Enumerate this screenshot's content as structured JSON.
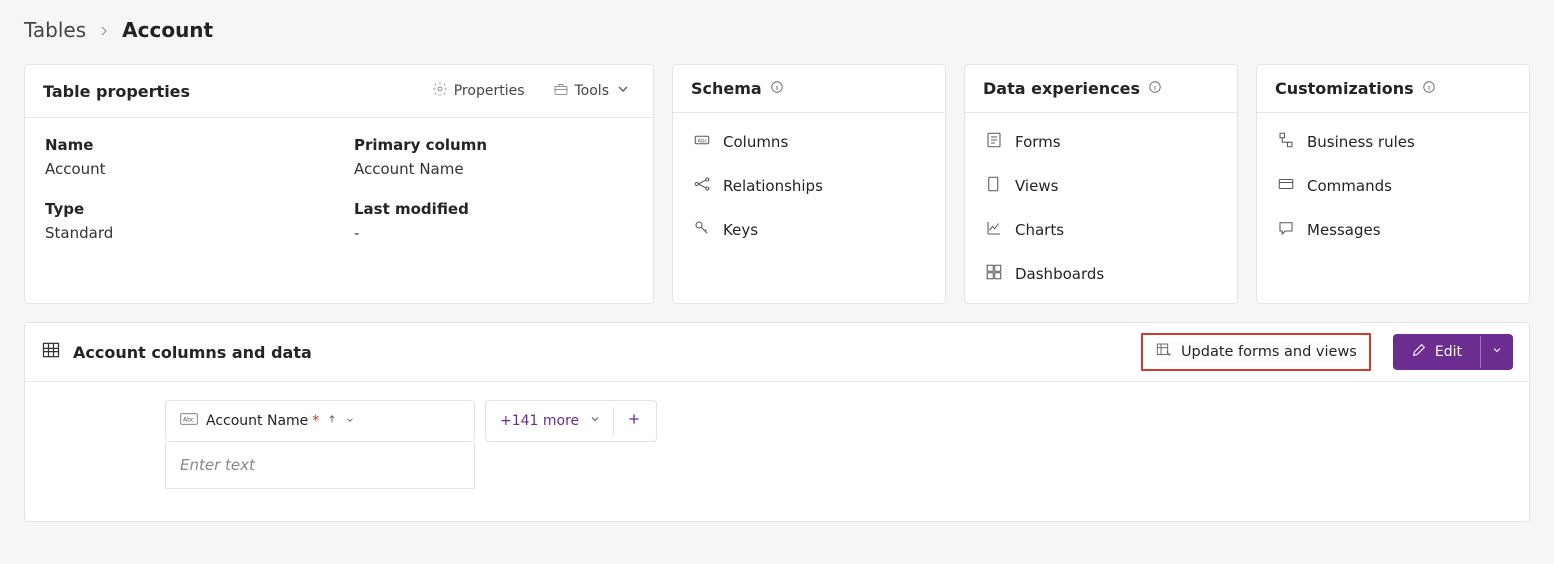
{
  "breadcrumb": {
    "root": "Tables",
    "current": "Account"
  },
  "table_properties": {
    "title": "Table properties",
    "properties_btn": "Properties",
    "tools_btn": "Tools",
    "labels": {
      "name": "Name",
      "primary_column": "Primary column",
      "type": "Type",
      "last_modified": "Last modified"
    },
    "values": {
      "name": "Account",
      "primary_column": "Account Name",
      "type": "Standard",
      "last_modified": "-"
    }
  },
  "schema": {
    "title": "Schema",
    "items": [
      {
        "label": "Columns"
      },
      {
        "label": "Relationships"
      },
      {
        "label": "Keys"
      }
    ]
  },
  "data_experiences": {
    "title": "Data experiences",
    "items": [
      {
        "label": "Forms"
      },
      {
        "label": "Views"
      },
      {
        "label": "Charts"
      },
      {
        "label": "Dashboards"
      }
    ]
  },
  "customizations": {
    "title": "Customizations",
    "items": [
      {
        "label": "Business rules"
      },
      {
        "label": "Commands"
      },
      {
        "label": "Messages"
      }
    ]
  },
  "data_section": {
    "title": "Account columns and data",
    "update_btn": "Update forms and views",
    "edit_btn": "Edit",
    "column_name": "Account Name",
    "more_label": "+141 more",
    "enter_text_placeholder": "Enter text"
  }
}
